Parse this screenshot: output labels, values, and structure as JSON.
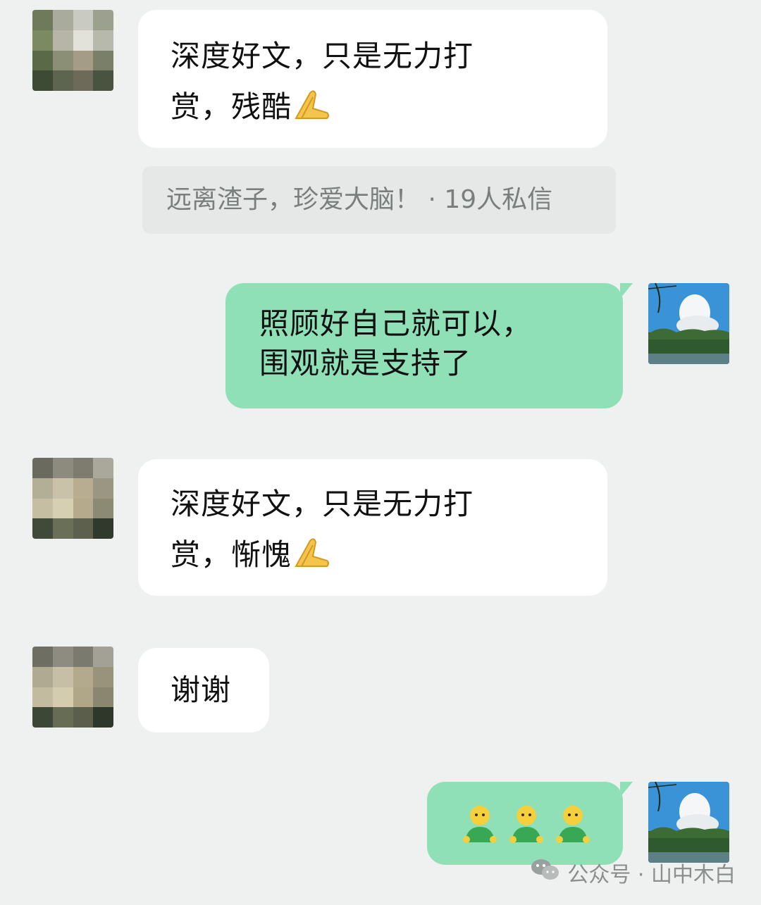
{
  "messages": [
    {
      "text": "深度好文，只是无力打\n赏，残酷"
    },
    {
      "quote": "远离渣子，珍爱大脑！  · 19人私信"
    },
    {
      "text": "照顾好自己就可以，\n围观就是支持了"
    },
    {
      "text": "深度好文，只是无力打\n赏，惭愧"
    },
    {
      "text": "谢谢"
    }
  ],
  "watermark": {
    "label": "公众号 · 山中木白"
  },
  "icons": {
    "pray": "pray-emoji-icon",
    "person": "person-emoji-icon",
    "wechat": "wechat-icon"
  },
  "colors": {
    "background": "#eef1f0",
    "incoming": "#ffffff",
    "outgoing": "#8fe0b7",
    "quote": "#e5e8e7"
  }
}
